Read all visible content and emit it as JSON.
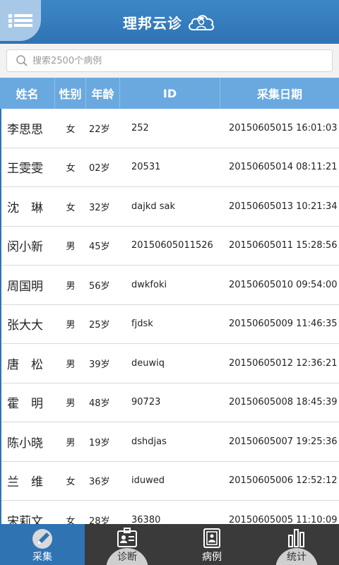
{
  "header": {
    "title": "理邦云诊",
    "menu_icon": "menu-icon",
    "logo_icon": "doctor-cloud-icon"
  },
  "search": {
    "placeholder": "搜索2500个病例",
    "value": ""
  },
  "table": {
    "columns": [
      "姓名",
      "性别",
      "年龄",
      "ID",
      "采集日期"
    ],
    "rows": [
      {
        "name": "李思思",
        "sex": "女",
        "age": "22岁",
        "id": "252",
        "date": "20150605015 16:01:03"
      },
      {
        "name": "王雯雯",
        "sex": "女",
        "age": "02岁",
        "id": "20531",
        "date": "20150605014 08:11:21"
      },
      {
        "name": "沈　琳",
        "sex": "女",
        "age": "32岁",
        "id": "dajkd sak",
        "date": "20150605013 10:21:34"
      },
      {
        "name": "闵小新",
        "sex": "男",
        "age": "45岁",
        "id": "20150605011526",
        "date": "20150605011 15:28:56"
      },
      {
        "name": "周国明",
        "sex": "男",
        "age": "56岁",
        "id": "dwkfoki",
        "date": "20150605010 09:54:00"
      },
      {
        "name": "张大大",
        "sex": "男",
        "age": "25岁",
        "id": "fjdsk",
        "date": "20150605009 11:46:35"
      },
      {
        "name": "唐　松",
        "sex": "男",
        "age": "39岁",
        "id": "deuwiq",
        "date": "20150605012 12:36:21"
      },
      {
        "name": "霍　明",
        "sex": "男",
        "age": "48岁",
        "id": "90723",
        "date": "20150605008 18:45:39"
      },
      {
        "name": "陈小晓",
        "sex": "男",
        "age": "19岁",
        "id": "dshdjas",
        "date": "20150605007 19:25:36"
      },
      {
        "name": "兰　维",
        "sex": "女",
        "age": "36岁",
        "id": "iduwed",
        "date": "20150605006 12:52:12"
      },
      {
        "name": "宋莉文",
        "sex": "女",
        "age": "28岁",
        "id": "36380",
        "date": "20150605005 11:10:09"
      }
    ]
  },
  "nav": {
    "items": [
      {
        "label": "采集",
        "icon": "pen-icon",
        "active": true
      },
      {
        "label": "诊断",
        "icon": "id-card-icon",
        "active": false
      },
      {
        "label": "病例",
        "icon": "record-book-icon",
        "active": false
      },
      {
        "label": "统计",
        "icon": "bar-chart-icon",
        "active": false
      }
    ]
  },
  "colors": {
    "header": "#2f73b3",
    "table_header": "#6aa9df",
    "nav_background": "#3a3a3a",
    "nav_active": "#2f73b3"
  }
}
